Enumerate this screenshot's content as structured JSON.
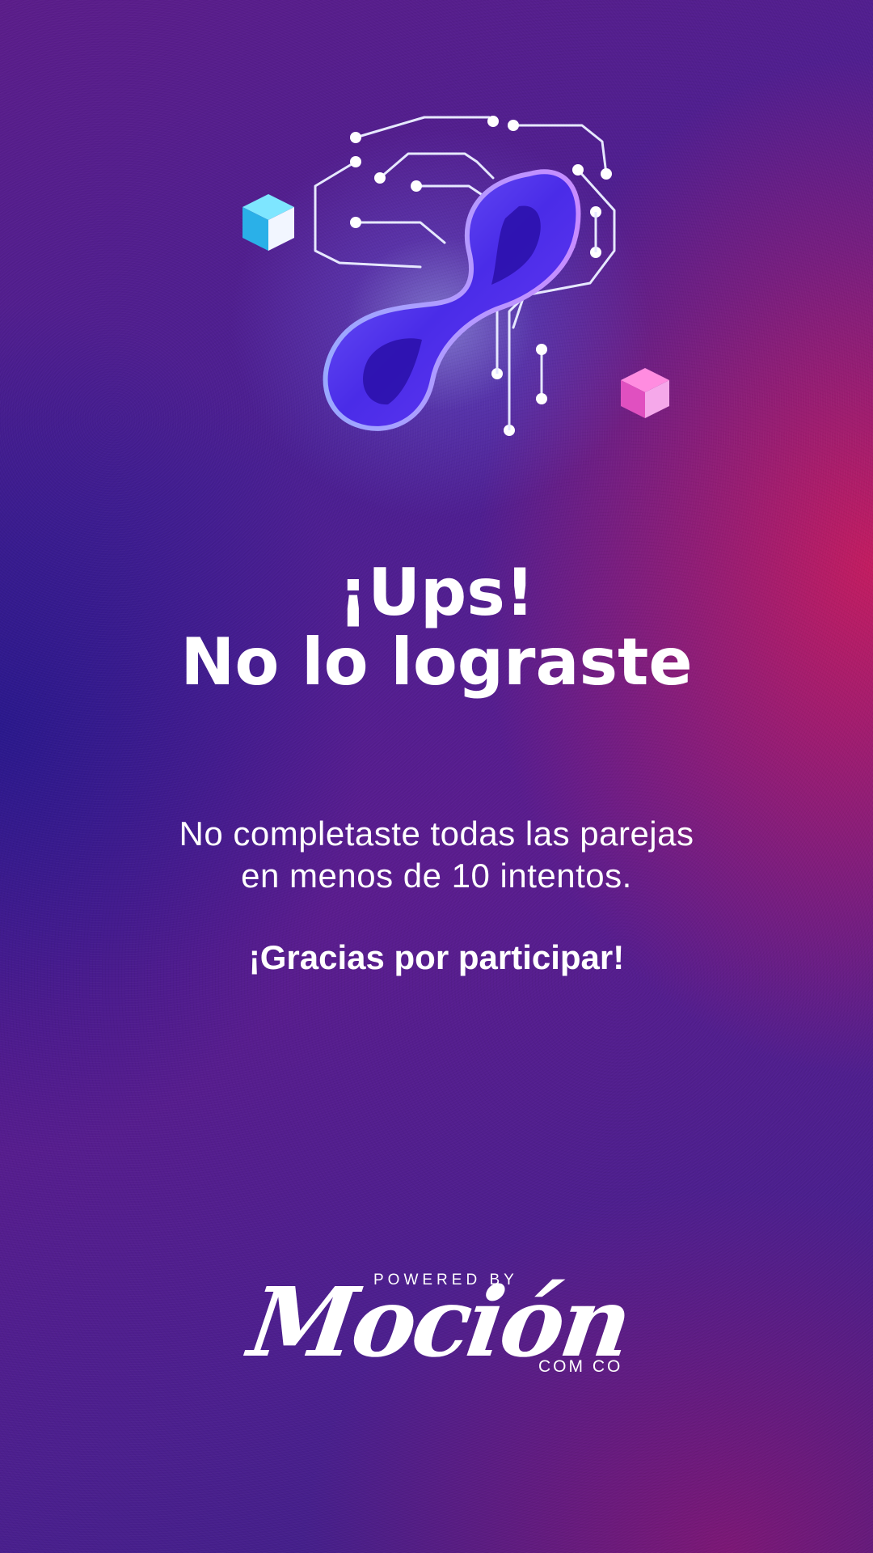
{
  "screen": {
    "title_line1": "¡Ups!",
    "title_line2": "No lo lograste",
    "message_line1": "No completaste todas las parejas",
    "message_line2": "en menos de 10 intentos.",
    "thanks": "¡Gracias por participar!"
  },
  "footer": {
    "powered_by": "POWERED BY",
    "brand": "Moción",
    "brand_suffix": "COM CO"
  },
  "icons": {
    "illustration": "circuit-brain-infinity-icon",
    "left_cube": "blue-cube-icon",
    "right_cube": "pink-cube-icon"
  },
  "colors": {
    "background_primary": "#4a1f92",
    "background_accent": "#d61c58",
    "infinity": "#5b3cf0",
    "cube_blue": "#38c8f0",
    "cube_pink": "#f060c8",
    "text": "#ffffff"
  }
}
